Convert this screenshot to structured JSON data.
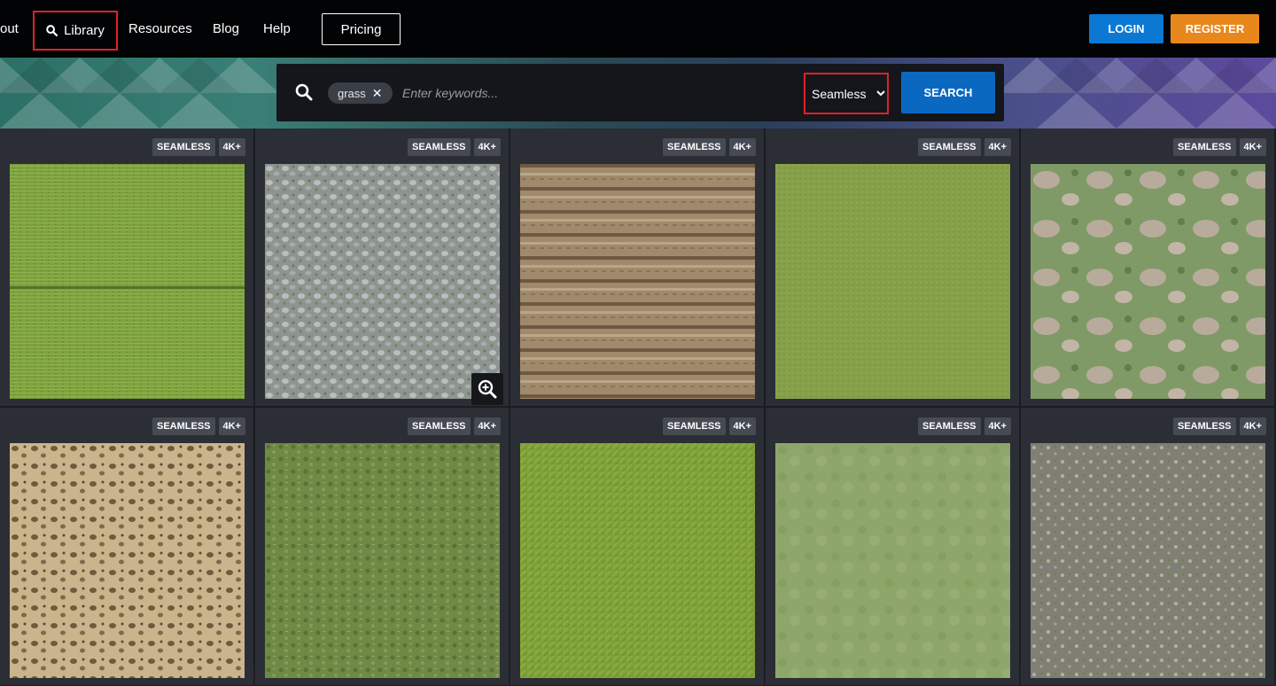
{
  "nav": {
    "about_partial": "out",
    "library": "Library",
    "resources": "Resources",
    "blog": "Blog",
    "help": "Help",
    "pricing": "Pricing",
    "login": "LOGIN",
    "register": "REGISTER"
  },
  "search": {
    "tag": "grass",
    "placeholder": "Enter keywords...",
    "filter": "Seamless",
    "button": "SEARCH"
  },
  "badges": {
    "seamless": "SEAMLESS",
    "res": "4K+"
  },
  "colors": {
    "login": "#0b78d3",
    "register": "#e8871c",
    "search_button": "#0b68c1",
    "highlight": "#e0202a"
  },
  "tiles": [
    {
      "texture": "mowed-grass-field"
    },
    {
      "texture": "gravel-with-moss"
    },
    {
      "texture": "plowed-dry-field"
    },
    {
      "texture": "short-green-grass"
    },
    {
      "texture": "patchy-grass-dirt"
    },
    {
      "texture": "dry-speckled-ground"
    },
    {
      "texture": "mixed-grass-moss"
    },
    {
      "texture": "lush-grass"
    },
    {
      "texture": "light-meadow-grass"
    },
    {
      "texture": "gravel-grass"
    }
  ]
}
